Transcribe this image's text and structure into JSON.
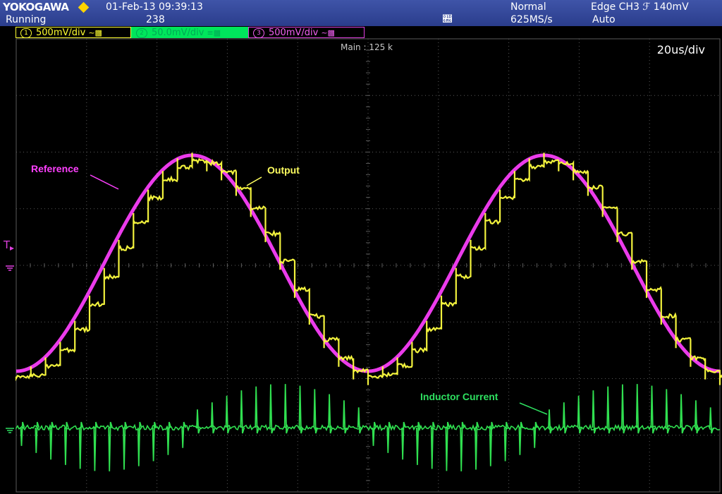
{
  "header": {
    "brand": "YOKOGAWA",
    "datetime": "01-Feb-13  09:39:13",
    "run_state": "Running",
    "acq_count": "238",
    "trigger_mode": "Normal",
    "sample_rate": "625MS/s",
    "trigger_source": "Edge CH3 ℱ 140mV",
    "trigger_auto": "Auto",
    "trigger_icon": "trigger-position-icon"
  },
  "channels": [
    {
      "num": "1",
      "scale": "500mV/div",
      "color": "#ffff30",
      "coupling_icon": "ac-coupling-icon"
    },
    {
      "num": "2",
      "scale": "50.0mV/div",
      "color": "#00e65c",
      "coupling_icon": "dc-coupling-icon"
    },
    {
      "num": "3",
      "scale": "500mV/div",
      "color": "#e040e0",
      "coupling_icon": "ac-coupling-icon"
    }
  ],
  "display": {
    "record_length": "Main : 125 k",
    "timebase": "20us/div",
    "grid_color": "#5a5a5a"
  },
  "annotations": {
    "reference": "Reference",
    "output": "Output",
    "inductor": "Inductor Current"
  },
  "chart_data": {
    "type": "line",
    "xlabel": "",
    "ylabel": "",
    "time_per_div_us": 20,
    "x_divisions": 10,
    "x_range_us": [
      0,
      200
    ],
    "grid": true,
    "series": [
      {
        "name": "Reference",
        "channel": 3,
        "color": "#ff40ff",
        "description": "sine",
        "period_us": 100,
        "peak_time_us": [
          44,
          144
        ],
        "trough_time_us": [
          0,
          94,
          194
        ]
      },
      {
        "name": "Output",
        "channel": 1,
        "color": "#ffff40",
        "description": "stepped",
        "steps_per_period": 24
      },
      {
        "name": "Inductor Current",
        "channel": 2,
        "color": "#30e050",
        "description": "spikes",
        "spikes_per_period": 24
      }
    ]
  }
}
